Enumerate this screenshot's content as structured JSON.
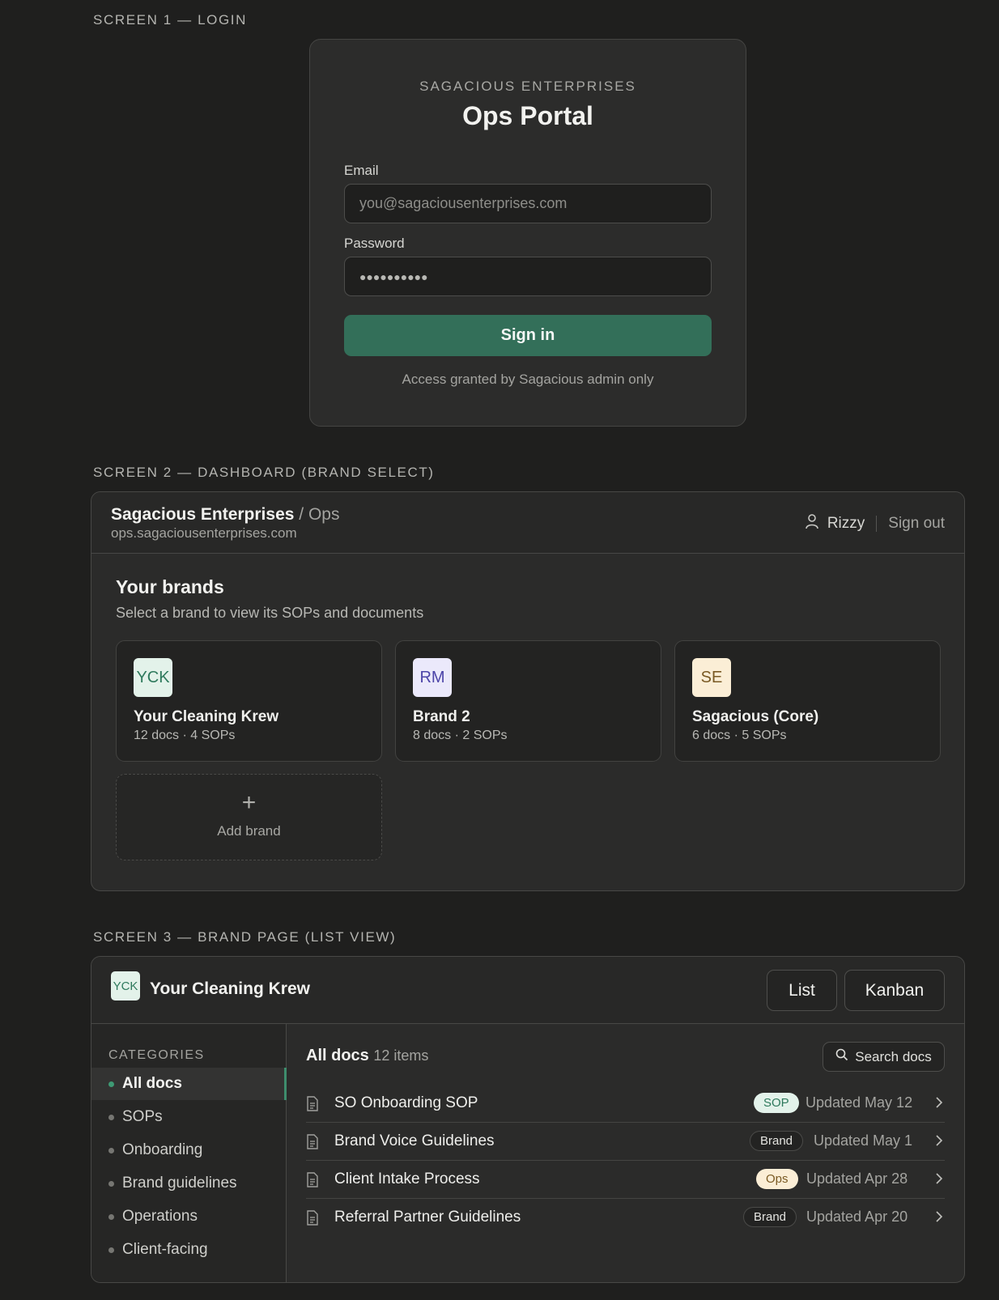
{
  "labels": {
    "screen1": "SCREEN 1 — LOGIN",
    "screen2": "SCREEN 2 — DASHBOARD (BRAND SELECT)",
    "screen3": "SCREEN 3 — BRAND PAGE (LIST VIEW)"
  },
  "login": {
    "brand": "SAGACIOUS ENTERPRISES",
    "title": "Ops Portal",
    "email_label": "Email",
    "email_placeholder": "you@sagaciousenterprises.com",
    "password_label": "Password",
    "password_value": "●●●●●●●●●●",
    "signin_label": "Sign in",
    "note": "Access granted by Sagacious admin only"
  },
  "dashboard": {
    "org": "Sagacious Enterprises",
    "section": "/ Ops",
    "domain": "ops.sagaciousenterprises.com",
    "user": "Rizzy",
    "signout": "Sign out",
    "title": "Your brands",
    "subtitle": "Select a brand to view its SOPs and documents",
    "brands": [
      {
        "initials": "YCK",
        "name": "Your Cleaning Krew",
        "meta": "12 docs · 4 SOPs",
        "bg": "#e3f2ea",
        "fg": "#2f7a5d"
      },
      {
        "initials": "RM",
        "name": "Brand 2",
        "meta": "8 docs · 2 SOPs",
        "bg": "#ebe9fb",
        "fg": "#4c44a8"
      },
      {
        "initials": "SE",
        "name": "Sagacious (Core)",
        "meta": "6 docs · 5 SOPs",
        "bg": "#fbeed6",
        "fg": "#7a5a24"
      }
    ],
    "add_plus": "+",
    "add_label": "Add brand"
  },
  "brand_page": {
    "initials": "YCK",
    "title": "Your Cleaning Krew",
    "view_list": "List",
    "view_kanban": "Kanban",
    "categories_title": "CATEGORIES",
    "categories": [
      "All docs",
      "SOPs",
      "Onboarding",
      "Brand guidelines",
      "Operations",
      "Client-facing"
    ],
    "active_category": "All docs",
    "list_title": "All docs",
    "list_count": "12 items",
    "search_label": "Search docs",
    "docs": [
      {
        "name": "SO Onboarding SOP",
        "tag": "SOP",
        "updated": "Updated May 12"
      },
      {
        "name": "Brand Voice Guidelines",
        "tag": "Brand",
        "updated": "Updated May 1"
      },
      {
        "name": "Client Intake Process",
        "tag": "Ops",
        "updated": "Updated Apr 28"
      },
      {
        "name": "Referral Partner Guidelines",
        "tag": "Brand",
        "updated": "Updated Apr 20"
      }
    ]
  },
  "colors": {
    "accent": "#336f59",
    "background": "#1f1f1e",
    "card": "#2c2c2b"
  }
}
